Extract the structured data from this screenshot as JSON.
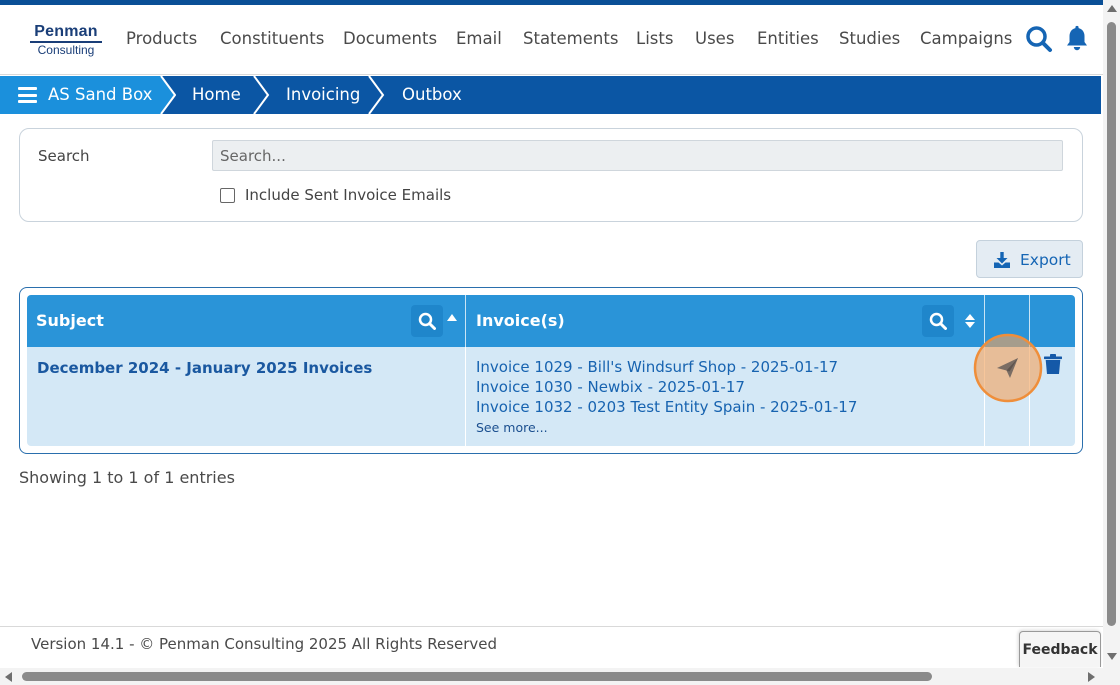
{
  "brand": {
    "line1": "Penman",
    "line2": "Consulting",
    "color": "#1a3e78"
  },
  "nav": [
    {
      "label": "Products"
    },
    {
      "label": "Constituents"
    },
    {
      "label": "Documents"
    },
    {
      "label": "Email"
    },
    {
      "label": "Statements"
    },
    {
      "label": "Lists"
    },
    {
      "label": "Uses"
    },
    {
      "label": "Entities"
    },
    {
      "label": "Studies"
    },
    {
      "label": "Campaigns"
    }
  ],
  "header_icons": {
    "search": "search-icon",
    "notifications": "bell-icon"
  },
  "breadcrumb": [
    {
      "label": "AS Sand Box"
    },
    {
      "label": "Home"
    },
    {
      "label": "Invoicing"
    },
    {
      "label": "Outbox"
    }
  ],
  "search": {
    "label": "Search",
    "placeholder": "Search...",
    "value": "",
    "include_sent_label": "Include Sent Invoice Emails",
    "include_sent_checked": false
  },
  "export_label": "Export",
  "table": {
    "columns": [
      {
        "label": "Subject"
      },
      {
        "label": "Invoice(s)"
      }
    ],
    "rows": [
      {
        "subject": "December 2024 - January 2025 Invoices",
        "invoices": [
          "Invoice 1029 - Bill's Windsurf Shop - 2025-01-17",
          "Invoice 1030 - Newbix - 2025-01-17",
          "Invoice 1032 - 0203 Test Entity Spain - 2025-01-17"
        ],
        "see_more": "See more...",
        "actions": [
          "send-icon",
          "trash-icon"
        ]
      }
    ]
  },
  "entries_info": "Showing 1 to 1 of 1 entries",
  "footer": "Version 14.1 - © Penman Consulting 2025 All Rights Reserved",
  "feedback_label": "Feedback",
  "colors": {
    "top_stripe": "#0a4f96",
    "breadcrumb_bg": "#0b56a4",
    "breadcrumb_active": "#1b90dc",
    "table_header": "#2a94d8",
    "row_bg": "#d4e8f6",
    "highlight": "#f5a65b"
  }
}
